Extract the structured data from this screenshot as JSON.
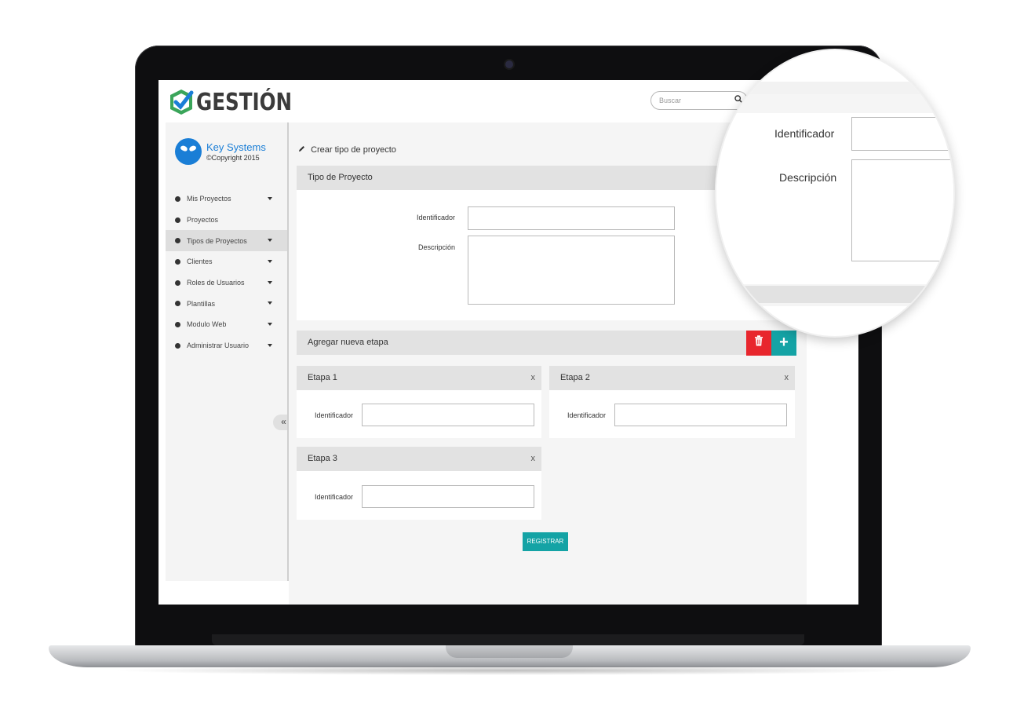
{
  "app": {
    "logo_text": "GESTIÓN",
    "brand_name": "Key Systems",
    "brand_copyright": "©Copyright 2015"
  },
  "search": {
    "placeholder": "Buscar"
  },
  "sidebar": {
    "items": [
      {
        "label": "Mis Proyectos",
        "has_caret": true
      },
      {
        "label": "Proyectos",
        "has_caret": false
      },
      {
        "label": "Tipos de Proyectos",
        "has_caret": true,
        "active": true
      },
      {
        "label": "Clientes",
        "has_caret": true
      },
      {
        "label": "Roles de Usuarios",
        "has_caret": true
      },
      {
        "label": "Plantillas",
        "has_caret": true
      },
      {
        "label": "Modulo Web",
        "has_caret": true
      },
      {
        "label": "Administrar Usuario",
        "has_caret": true
      }
    ],
    "collapse_label": "«"
  },
  "main": {
    "page_title": "Crear tipo de proyecto",
    "tipo": {
      "heading": "Tipo de Proyecto",
      "identificador_label": "Identificador",
      "descripcion_label": "Descripción"
    },
    "etapas": {
      "heading": "Agregar nueva etapa",
      "items": [
        {
          "title": "Etapa 1",
          "close": "x",
          "field_label": "Identificador"
        },
        {
          "title": "Etapa 2",
          "close": "x",
          "field_label": "Identificador"
        },
        {
          "title": "Etapa 3",
          "close": "x",
          "field_label": "Identificador"
        }
      ]
    },
    "register_label": "REGISTRAR"
  },
  "magnifier": {
    "identificador_label": "Identificador",
    "descripcion_label": "Descripción"
  },
  "colors": {
    "accent_teal": "#14a3a5",
    "delete_red": "#e8262d",
    "brand_blue": "#1a7ed6",
    "logo_green": "#3aa55a"
  },
  "icons": [
    "pencil-icon",
    "search-icon",
    "trash-icon",
    "plus-icon",
    "close-icon",
    "chevron-left-double-icon",
    "logo-check-icon",
    "alien-avatar-icon"
  ]
}
